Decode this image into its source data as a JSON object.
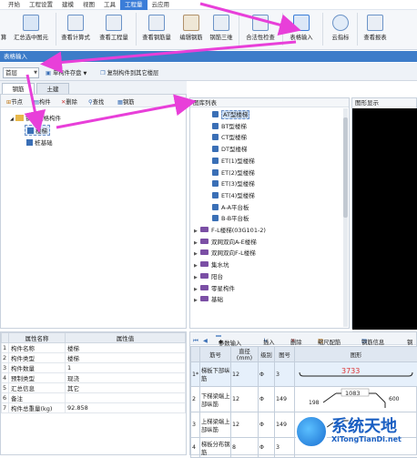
{
  "menu": {
    "items": [
      {
        "label": "开始"
      },
      {
        "label": "工程设置"
      },
      {
        "label": "建模"
      },
      {
        "label": "视图"
      },
      {
        "label": "工具"
      },
      {
        "label": "工程量"
      },
      {
        "label": "云应用"
      }
    ],
    "active_index": 5
  },
  "ribbon": {
    "buttons": [
      {
        "label": "算"
      },
      {
        "label": "汇总选中图元"
      },
      {
        "label": "查看计算式"
      },
      {
        "label": "查看工程量"
      },
      {
        "label": "查看钢筋量"
      },
      {
        "label": "编辑钢筋"
      },
      {
        "label": "钢筋三维"
      },
      {
        "label": "合法性检查"
      },
      {
        "label": "表格输入"
      },
      {
        "label": "云指标"
      },
      {
        "label": "查看报表"
      }
    ]
  },
  "window_title": "表格输入",
  "toolbar2": {
    "floor_value": "首层",
    "single_save": "单构件存盘",
    "copy_to_floor": "复制构件到其它楼层"
  },
  "tabs": [
    {
      "label": "钢筋"
    },
    {
      "label": "土建"
    }
  ],
  "left_toolbar": {
    "node": "节点",
    "component": "构件",
    "delete": "删除",
    "search": "查找",
    "extra": "钢筋"
  },
  "tree": {
    "root": "钢筋表格构件",
    "children": [
      {
        "label": "楼梯"
      },
      {
        "label": "桩基础"
      }
    ]
  },
  "properties": {
    "header_name": "属性名称",
    "header_value": "属性值",
    "rows": [
      {
        "num": "1",
        "name": "构件名称",
        "value": "楼梯"
      },
      {
        "num": "2",
        "name": "构件类型",
        "value": "楼梯"
      },
      {
        "num": "3",
        "name": "构件数量",
        "value": "1"
      },
      {
        "num": "4",
        "name": "预制类型",
        "value": "现浇"
      },
      {
        "num": "5",
        "name": "汇总信息",
        "value": "其它"
      },
      {
        "num": "6",
        "name": "备注",
        "value": ""
      },
      {
        "num": "7",
        "name": "构件总重量(kg)",
        "value": "92.858"
      }
    ]
  },
  "component_list": {
    "title": "图库列表",
    "items": [
      {
        "label": "AT型楼梯",
        "kind": "stair",
        "selected": true
      },
      {
        "label": "BT型楼梯",
        "kind": "stair"
      },
      {
        "label": "CT型楼梯",
        "kind": "stair"
      },
      {
        "label": "DT型楼梯",
        "kind": "stair"
      },
      {
        "label": "ET(1)型楼梯",
        "kind": "stair"
      },
      {
        "label": "ET(2)型楼梯",
        "kind": "stair"
      },
      {
        "label": "ET(3)型楼梯",
        "kind": "stair"
      },
      {
        "label": "ET(4)型楼梯",
        "kind": "stair"
      },
      {
        "label": "A-A平台板",
        "kind": "stair"
      },
      {
        "label": "B-B平台板",
        "kind": "stair"
      },
      {
        "label": "F-L楼梯(03G101-2)",
        "kind": "group"
      },
      {
        "label": "双网双向A-E楼梯",
        "kind": "group"
      },
      {
        "label": "双网双向F-L楼梯",
        "kind": "group"
      },
      {
        "label": "集水坑",
        "kind": "group"
      },
      {
        "label": "阳台",
        "kind": "group"
      },
      {
        "label": "零星构件",
        "kind": "group"
      },
      {
        "label": "基础",
        "kind": "group"
      }
    ]
  },
  "preview": {
    "title": "图形显示"
  },
  "grid_toolbar": {
    "params_input": "参数输入",
    "insert": "插入",
    "delete": "删除",
    "ruler_rebar": "缩尺配筋",
    "rebar_info": "钢筋信息",
    "extra": "钢"
  },
  "grid": {
    "headers": [
      "筋号",
      "直径(mm)",
      "级别",
      "图号",
      "图形"
    ],
    "rows": [
      {
        "num": "1*",
        "name": "梯板下部纵筋",
        "dia": "12",
        "grade": "Φ",
        "fig": "3",
        "shape": "3733"
      },
      {
        "num": "2",
        "name": "下梯梁端上部纵筋",
        "dia": "12",
        "grade": "Φ",
        "fig": "149",
        "shape": "1083"
      },
      {
        "num": "3",
        "name": "上梯梁端上部纵筋",
        "dia": "12",
        "grade": "Φ",
        "fig": "149",
        "shape": ""
      },
      {
        "num": "4",
        "name": "梯板分布钢筋",
        "dia": "8",
        "grade": "Φ",
        "fig": "3",
        "shape": ""
      }
    ],
    "shape2_left": "198",
    "shape2_right": "600"
  },
  "watermark": {
    "title": "系统天地",
    "url": "XiTongTianDi.net"
  },
  "colors": {
    "accent": "#3b7dd8",
    "arrow": "#e83fd9",
    "title_bar": "#3d7cc9"
  }
}
